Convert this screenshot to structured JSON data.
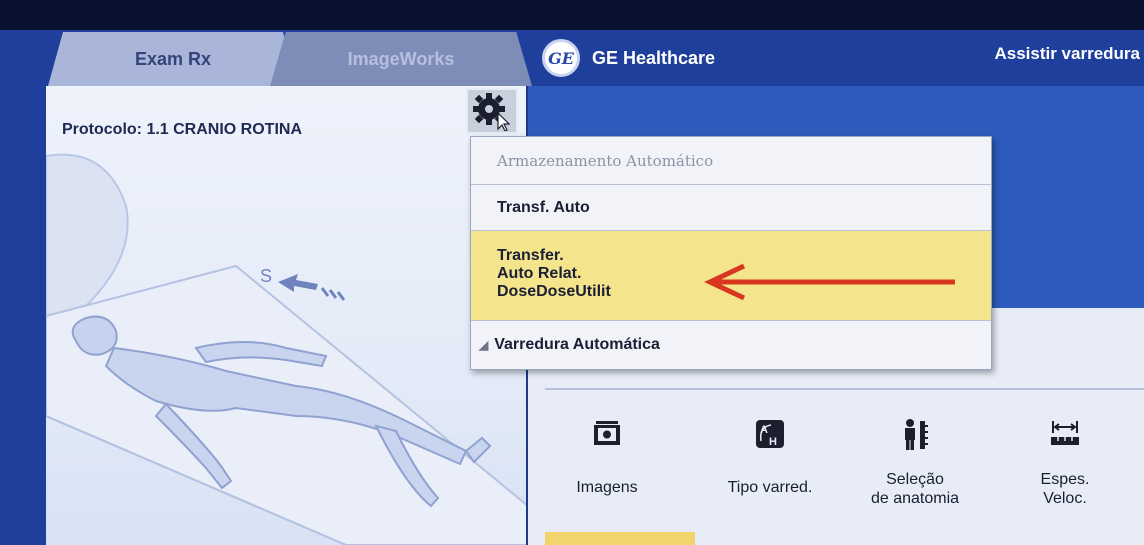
{
  "tabs": [
    {
      "label": "Exam Rx",
      "active": true
    },
    {
      "label": "ImageWorks",
      "active": false
    }
  ],
  "brand": {
    "name": "GE Healthcare",
    "logo_text": "GE"
  },
  "assist_label": "Assistir varredura",
  "protocol_label": "Protocolo: 1.1 CRANIO ROTINA",
  "patient_graphic": {
    "direction_letter": "S"
  },
  "settings_icon": "gear-icon",
  "menu": {
    "items": [
      {
        "label": "Armazenamento Automático",
        "enabled": false
      },
      {
        "label": "Transf. Auto",
        "enabled": true
      },
      {
        "label_lines": [
          "Transfer.",
          "Auto Relat.",
          "DoseDoseUtilit"
        ],
        "highlighted": true
      },
      {
        "label": "Varredura Automática",
        "checked": true
      }
    ]
  },
  "toolbar": {
    "items": [
      {
        "label": "Imagens",
        "icon": "images-icon"
      },
      {
        "label": "Tipo varred.",
        "icon": "scan-type-icon"
      },
      {
        "label_lines": [
          "Seleção",
          "de anatomia"
        ],
        "icon": "anatomy-icon"
      },
      {
        "label_lines": [
          "Espes.",
          "Veloc."
        ],
        "icon": "thickness-speed-icon"
      }
    ]
  },
  "colors": {
    "highlight": "#f4e58c",
    "annotation_arrow": "#d8361e",
    "header_blue": "#2e5bbd"
  }
}
